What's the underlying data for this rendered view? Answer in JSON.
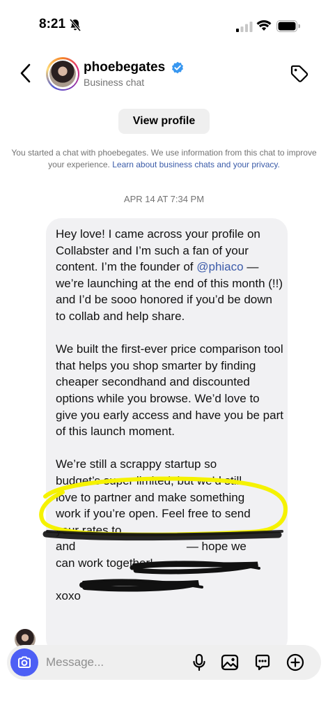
{
  "status_bar": {
    "time": "8:21"
  },
  "header": {
    "username": "phoebegates",
    "subtitle": "Business chat"
  },
  "view_profile_label": "View profile",
  "notice": {
    "text": "You started a chat with phoebegates. We use information from this chat to improve your experience.",
    "link": "Learn about business chats and your privacy."
  },
  "timestamp": "APR 14 AT 7:34 PM",
  "message": {
    "p1_before": "Hey love! I came across your profile on Collabster and I’m such a fan of your content. I’m the founder of ",
    "mention": "@phiaco",
    "p1_after": " — we’re launching at the end of this month (!!) and I’d be sooo honored if you’d be down to collab and help share.",
    "p2": "We built the first-ever price comparison tool that helps you shop smarter by finding cheaper secondhand and discounted options while you browse. We’d love to give you early access and have you be part of this launch moment.",
    "p3_line1": "We’re still a scrappy startup so",
    "p3_line2": "budget’s super limited, but we’d still",
    "p3_line3": "love to partner and make something",
    "p3_line4": "work if you’re open. Feel free to send",
    "p3_line5_start": "your rates to ",
    "p3_line6_start": "and ",
    "p3_line6_end": " — hope we",
    "p3_line7": "can work together!",
    "signoff": "xoxo"
  },
  "composer": {
    "placeholder": "Message..."
  },
  "colors": {
    "accent_blue": "#4d5ff5",
    "link_blue": "#3a5ba8",
    "highlight_yellow": "#f5f200",
    "bubble_bg": "#f1f1f3"
  },
  "icons": [
    "bell-slash-icon",
    "signal-icon",
    "wifi-icon",
    "battery-icon",
    "back-chevron-icon",
    "verified-badge-icon",
    "tag-icon",
    "camera-icon",
    "microphone-icon",
    "gallery-icon",
    "sticker-chat-icon",
    "plus-circle-icon"
  ]
}
